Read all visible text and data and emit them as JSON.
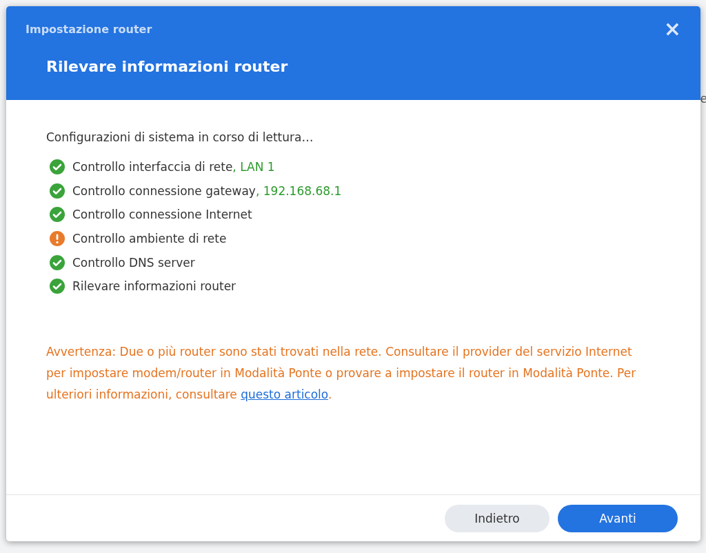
{
  "background_page": {
    "text_fragment": "e"
  },
  "window": {
    "title": "Impostazione router",
    "close": "×"
  },
  "header": {
    "heading": "Rilevare informazioni router"
  },
  "body": {
    "intro": "Configurazioni di sistema in corso di lettura…",
    "checks": [
      {
        "kind": "ok",
        "label": "Controllo interfaccia di rete",
        "detail": ", LAN 1"
      },
      {
        "kind": "ok",
        "label": "Controllo connessione gateway",
        "detail": ", 192.168.68.1"
      },
      {
        "kind": "ok",
        "label": "Controllo connessione Internet"
      },
      {
        "kind": "warning",
        "label": "Controllo ambiente di rete"
      },
      {
        "kind": "ok",
        "label": "Controllo DNS server"
      },
      {
        "kind": "ok",
        "label": "Rilevare informazioni router"
      }
    ],
    "warning": {
      "text": "Avvertenza: Due o più router sono stati trovati nella rete. Consultare il provider del servizio Internet per impostare modem/router in Modalità Ponte o provare a impostare il router in Modalità Ponte. Per ulteriori informazioni, consultare ",
      "link": "questo articolo",
      "after": "."
    }
  },
  "buttons": [
    {
      "label": "Indietro",
      "kind": "secondary"
    },
    {
      "label": "Avanti",
      "kind": "primary"
    }
  ]
}
